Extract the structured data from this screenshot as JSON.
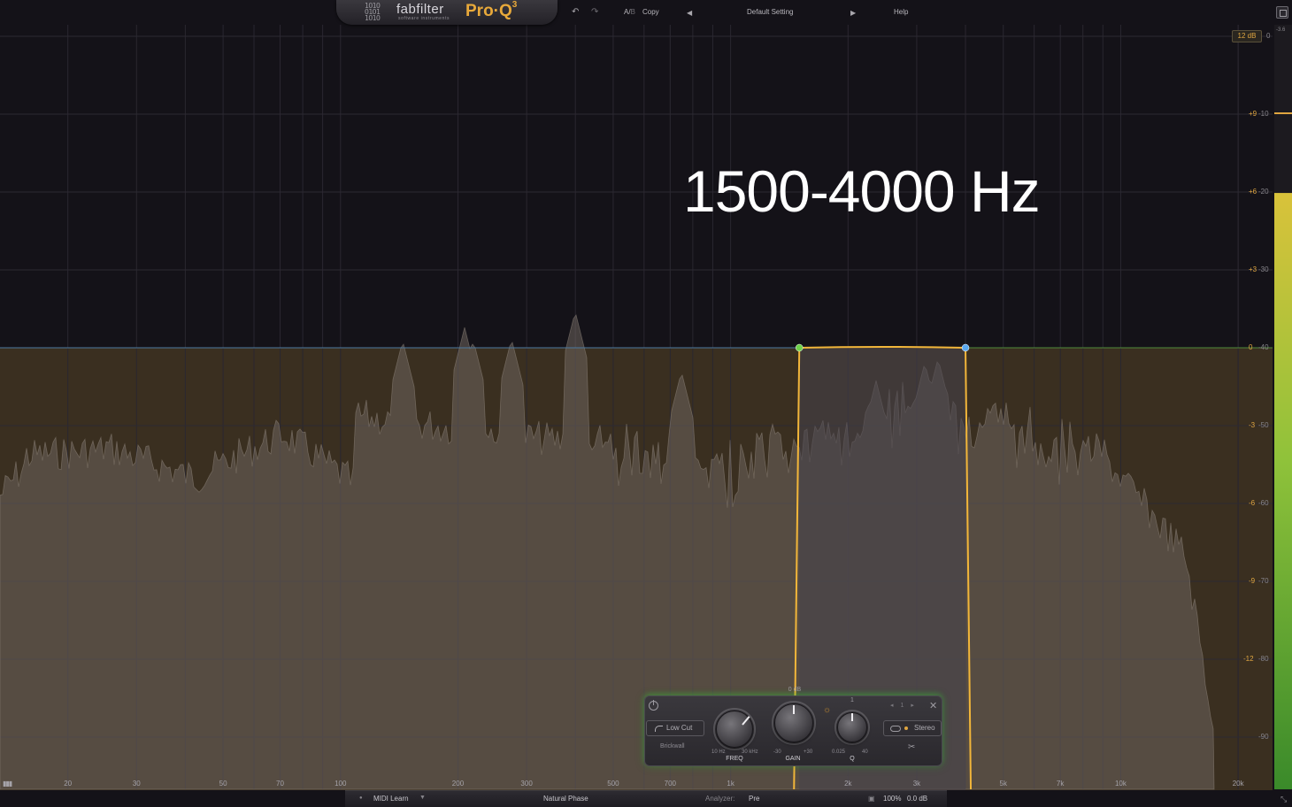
{
  "app": {
    "brand": "fabfilter",
    "brand_sub": "software instruments",
    "product": "Pro·Q",
    "product_version": "3"
  },
  "toolbar": {
    "ab_label": "A/",
    "ab_b": "B",
    "copy_label": "Copy",
    "preset_label": "Default Setting",
    "help_label": "Help"
  },
  "annotation": "1500-4000 Hz",
  "scale": {
    "range_label": "12 dB",
    "peak_top": "-3.6",
    "gain_labels": [
      "+9",
      "+6",
      "+3",
      "0",
      "-3",
      "-6",
      "-9",
      "-12"
    ],
    "analyzer_labels": [
      "0",
      "-10",
      "-20",
      "-30",
      "-40",
      "-50",
      "-60",
      "-70",
      "-80",
      "-90"
    ],
    "meter_level": 0.78
  },
  "frequency_axis": {
    "labels": [
      "20",
      "30",
      "50",
      "70",
      "100",
      "200",
      "300",
      "500",
      "700",
      "1k",
      "2k",
      "3k",
      "5k",
      "7k",
      "10k",
      "20k"
    ],
    "values": [
      20,
      30,
      50,
      70,
      100,
      200,
      300,
      500,
      700,
      1000,
      2000,
      3000,
      5000,
      7000,
      10000,
      20000
    ]
  },
  "eq_band": {
    "type": "band-pass (low cut + high cut brickwall)",
    "low_freq_hz": 1500,
    "high_freq_hz": 4000,
    "gain_db": 0
  },
  "band_panel": {
    "shape_label": "Low Cut",
    "slope_label": "Brickwall",
    "stereo_label": "Stereo",
    "band_index": "1",
    "gain_top": "0 dB",
    "q_top": "1",
    "freq": {
      "label": "FREQ",
      "min": "10 Hz",
      "max": "30 kHz"
    },
    "gain": {
      "label": "GAIN",
      "min": "-30",
      "max": "+30"
    },
    "q": {
      "label": "Q",
      "min": "0.025",
      "max": "40"
    }
  },
  "bottombar": {
    "midi_learn": "MIDI Learn",
    "phase_mode": "Natural Phase",
    "analyzer_label": "Analyzer:",
    "analyzer_value": "Pre",
    "zoom": "100%",
    "output_gain": "0.0 dB"
  },
  "colors": {
    "accent": "#e0a640",
    "band_curve": "#f2b63a",
    "node_low": "#6fd24a",
    "node_high": "#5aa8f0",
    "zero_line": "#4c7aa0"
  }
}
